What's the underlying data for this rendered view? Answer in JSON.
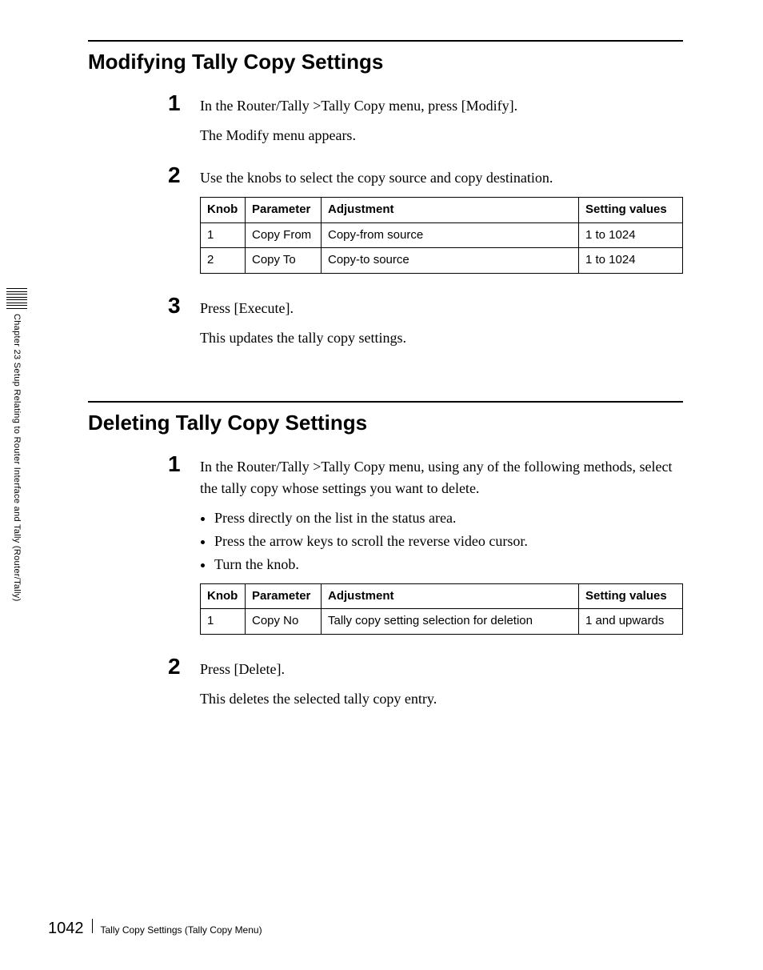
{
  "sidebar": {
    "label": "Chapter 23  Setup Relating to Router Interface and Tally (Router/Tally)"
  },
  "sections": [
    {
      "heading": "Modifying Tally Copy Settings",
      "steps": [
        {
          "num": "1",
          "paras": [
            "In the Router/Tally >Tally Copy menu, press [Modify].",
            "The Modify menu appears."
          ]
        },
        {
          "num": "2",
          "paras": [
            "Use the knobs to select the copy source and copy destination."
          ],
          "table": {
            "headers": [
              "Knob",
              "Parameter",
              "Adjustment",
              "Setting values"
            ],
            "rows": [
              [
                "1",
                "Copy From",
                "Copy-from source",
                "1 to 1024"
              ],
              [
                "2",
                "Copy To",
                "Copy-to source",
                "1 to 1024"
              ]
            ]
          }
        },
        {
          "num": "3",
          "paras": [
            "Press [Execute].",
            "This updates the tally copy settings."
          ]
        }
      ]
    },
    {
      "heading": "Deleting Tally Copy Settings",
      "steps": [
        {
          "num": "1",
          "paras": [
            "In the Router/Tally >Tally Copy menu, using any of the following methods, select the tally copy whose settings you want to delete."
          ],
          "bullets": [
            "Press directly on the list in the status area.",
            "Press the arrow keys to scroll the reverse video cursor.",
            "Turn the knob."
          ],
          "table": {
            "headers": [
              "Knob",
              "Parameter",
              "Adjustment",
              "Setting values"
            ],
            "rows": [
              [
                "1",
                "Copy No",
                "Tally copy setting selection for deletion",
                "1 and upwards"
              ]
            ]
          }
        },
        {
          "num": "2",
          "paras": [
            "Press [Delete].",
            "This deletes the selected tally copy entry."
          ]
        }
      ]
    }
  ],
  "footer": {
    "page": "1042",
    "title": "Tally Copy Settings (Tally Copy Menu)"
  }
}
